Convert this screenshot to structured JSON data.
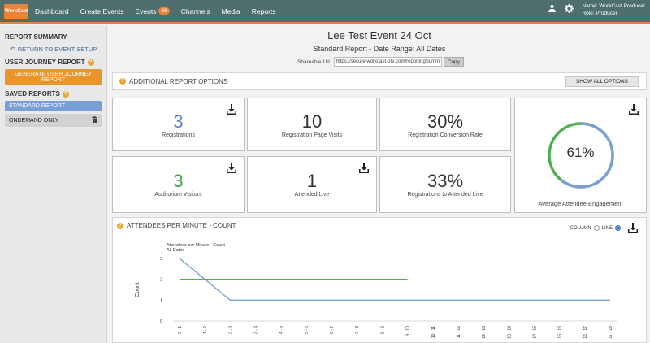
{
  "nav": {
    "logo": "WorkCast",
    "items": [
      {
        "label": "Dashboard"
      },
      {
        "label": "Create Events"
      },
      {
        "label": "Events",
        "badge": "38"
      },
      {
        "label": "Channels"
      },
      {
        "label": "Media"
      },
      {
        "label": "Reports"
      }
    ],
    "user_name": "Name: WorkCast Producer",
    "user_role": "Role: Producer"
  },
  "sidebar": {
    "report_summary": "REPORT SUMMARY",
    "return_link": "RETURN TO EVENT SETUP",
    "user_journey": "USER JOURNEY REPORT",
    "generate_btn": "GENERATE USER JOURNEY REPORT",
    "saved_reports": "SAVED REPORTS",
    "standard_report": "STANDARD REPORT",
    "ondemand_only": "ONDEMAND ONLY"
  },
  "header": {
    "title": "Lee Test Event 24 Oct",
    "subtitle": "Standard Report - Date Range:  All Dates",
    "share_label": "Shareable Url",
    "share_url": "https://secure.workcast-ote.com/reportingSumm",
    "copy_label": "Copy"
  },
  "options": {
    "label": "ADDITIONAL REPORT OPTIONS",
    "show_all": "SHOW ALL OPTIONS"
  },
  "cards": {
    "registrations": {
      "value": "3",
      "label": "Registrations",
      "color": "#5b86c5"
    },
    "page_visits": {
      "value": "10",
      "label": "Registration Page Visits"
    },
    "conversion": {
      "value": "30%",
      "label": "Registration Conversion Rate"
    },
    "auditorium": {
      "value": "3",
      "label": "Auditorium Visitors",
      "color": "#3aa64a"
    },
    "attended_live": {
      "value": "1",
      "label": "Attended Live"
    },
    "reg_to_attended": {
      "value": "33%",
      "label": "Registrations to Attended Live"
    },
    "engagement": {
      "value": "61%",
      "label": "Average Attendee Engagement",
      "fraction": 0.61
    }
  },
  "chart_panel": {
    "heading": "ATTENDEES PER MINUTE - COUNT",
    "column_label": "COLUMN",
    "line_label": "LINE",
    "selected": "line"
  },
  "chart_data": {
    "type": "line",
    "title": "Attendees per Minute - Count",
    "subtitle": "All Dates",
    "ylabel": "Count",
    "ylim": [
      0,
      3
    ],
    "yticks": [
      0,
      1,
      2,
      3
    ],
    "categories": [
      "0 - 1",
      "1 - 2",
      "2 - 3",
      "3 - 4",
      "4 - 5",
      "5 - 6",
      "6 - 7",
      "7 - 8",
      "8 - 9",
      "9 - 10",
      "10 - 11",
      "11 - 12",
      "12 - 13",
      "13 - 14",
      "14 - 15",
      "15 - 16",
      "16 - 17",
      "17 - 18"
    ],
    "series": [
      {
        "color": "#7b9fd4",
        "values": [
          3,
          2,
          1,
          1,
          1,
          1,
          1,
          1,
          1,
          1,
          1,
          1,
          1,
          1,
          1,
          1,
          1,
          1
        ]
      },
      {
        "color": "#4caf50",
        "values": [
          2,
          2,
          2,
          2,
          2,
          2,
          2,
          2,
          2,
          2,
          null,
          null,
          null,
          null,
          null,
          null,
          null,
          null
        ]
      }
    ]
  }
}
